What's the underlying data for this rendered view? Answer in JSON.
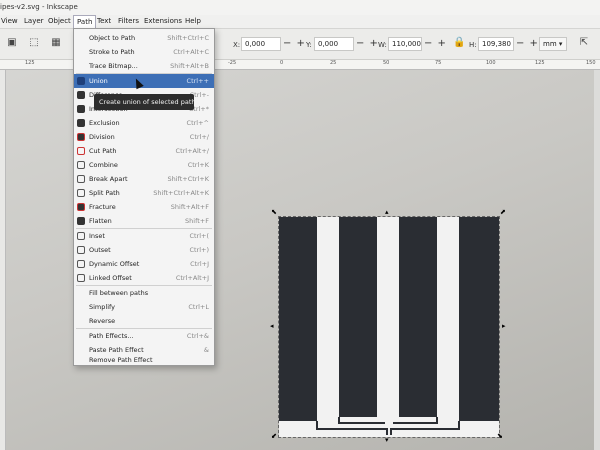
{
  "window": {
    "title": "ipes-v2.svg - Inkscape"
  },
  "menubar": {
    "items": [
      "View",
      "Layer",
      "Object",
      "Path",
      "Text",
      "Filters",
      "Extensions",
      "Help"
    ],
    "open_menu": "Path"
  },
  "toolbar": {
    "x_label": "X:",
    "x_value": "0,000",
    "y_label": "Y:",
    "y_value": "0,000",
    "w_label": "W:",
    "w_value": "110,000",
    "h_label": "H:",
    "h_value": "109,380",
    "unit": "mm",
    "plus_minus": "− +"
  },
  "ruler": {
    "ticks": [
      "125",
      "100",
      "75",
      "-25",
      "0",
      "25",
      "50",
      "75",
      "100",
      "125",
      "150"
    ]
  },
  "path_menu": {
    "items": [
      {
        "label": "Object to Path",
        "shortcut": "Shift+Ctrl+C",
        "icon": "object-to-path-icon"
      },
      {
        "label": "Stroke to Path",
        "shortcut": "Ctrl+Alt+C",
        "icon": "stroke-to-path-icon"
      },
      {
        "label": "Trace Bitmap...",
        "shortcut": "Shift+Alt+B",
        "icon": "trace-bitmap-icon"
      },
      {
        "label": "Union",
        "shortcut": "Ctrl++",
        "icon": "union-icon",
        "highlighted": true
      },
      {
        "label": "Difference",
        "shortcut": "Ctrl+-",
        "icon": "difference-icon"
      },
      {
        "label": "Intersection",
        "shortcut": "Ctrl+*",
        "icon": "intersection-icon"
      },
      {
        "label": "Exclusion",
        "shortcut": "Ctrl+^",
        "icon": "exclusion-icon"
      },
      {
        "label": "Division",
        "shortcut": "Ctrl+/",
        "icon": "division-icon"
      },
      {
        "label": "Cut Path",
        "shortcut": "Ctrl+Alt+/",
        "icon": "cut-path-icon"
      },
      {
        "label": "Combine",
        "shortcut": "Ctrl+K",
        "icon": "combine-icon"
      },
      {
        "label": "Break Apart",
        "shortcut": "Shift+Ctrl+K",
        "icon": "break-apart-icon"
      },
      {
        "label": "Split Path",
        "shortcut": "Shift+Ctrl+Alt+K",
        "icon": "split-path-icon"
      },
      {
        "label": "Fracture",
        "shortcut": "Shift+Alt+F",
        "icon": "fracture-icon"
      },
      {
        "label": "Flatten",
        "shortcut": "Shift+F",
        "icon": "flatten-icon"
      },
      {
        "label": "Inset",
        "shortcut": "Ctrl+(",
        "icon": "inset-icon"
      },
      {
        "label": "Outset",
        "shortcut": "Ctrl+)",
        "icon": "outset-icon"
      },
      {
        "label": "Dynamic Offset",
        "shortcut": "Ctrl+J",
        "icon": "dynamic-offset-icon"
      },
      {
        "label": "Linked Offset",
        "shortcut": "Ctrl+Alt+J",
        "icon": "linked-offset-icon"
      },
      {
        "label": "Fill between paths",
        "shortcut": "",
        "icon": ""
      },
      {
        "label": "Simplify",
        "shortcut": "Ctrl+L",
        "icon": ""
      },
      {
        "label": "Reverse",
        "shortcut": "",
        "icon": ""
      },
      {
        "label": "Path Effects...",
        "shortcut": "Ctrl+&",
        "icon": ""
      },
      {
        "label": "Paste Path Effect",
        "shortcut": "&",
        "icon": ""
      },
      {
        "label": "Remove Path Effect",
        "shortcut": "",
        "icon": ""
      }
    ],
    "tooltip": "Create union of selected paths"
  },
  "colors": {
    "highlight": "#3d6fb6",
    "stripe_dark": "#2a2d33",
    "stripe_light": "#f2f2f2"
  }
}
